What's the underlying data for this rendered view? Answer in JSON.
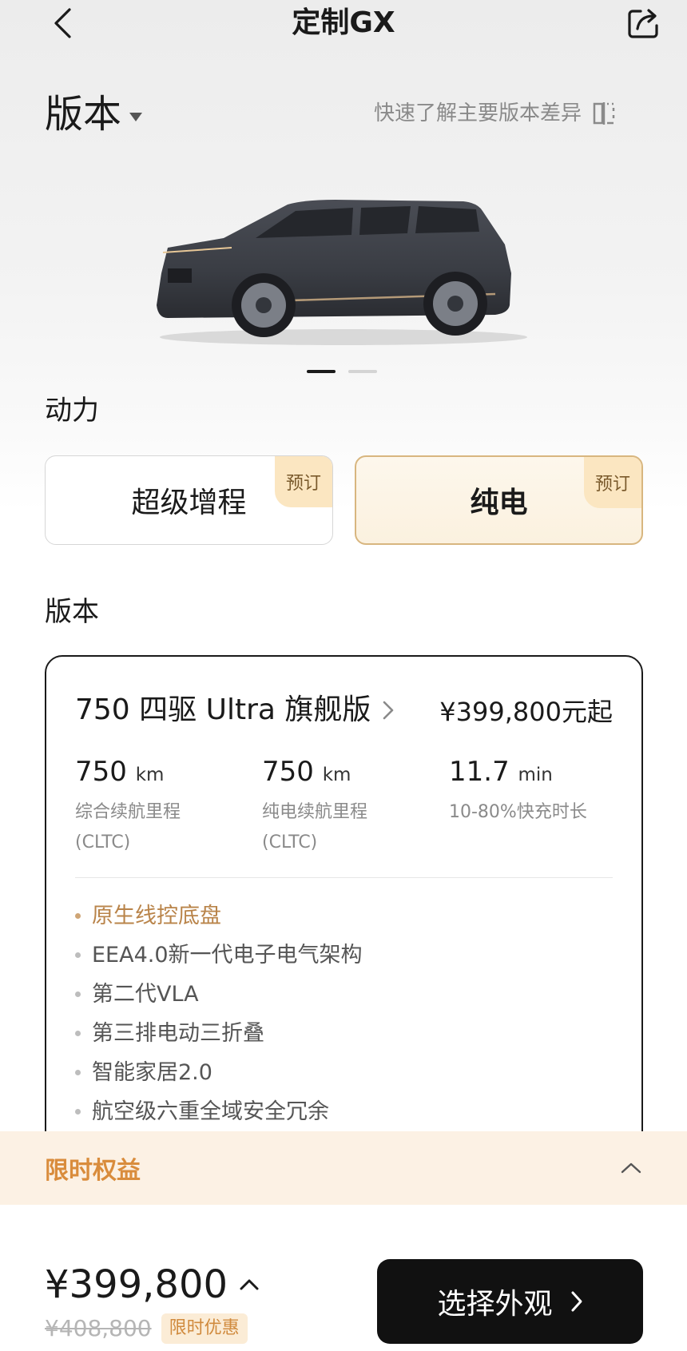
{
  "header": {
    "title": "定制GX",
    "back_icon": "chevron-left-icon",
    "share_icon": "share-icon"
  },
  "version_selector": {
    "label": "版本",
    "compare_link": "快速了解主要版本差异",
    "compare_icon": "compare-icon"
  },
  "carousel": {
    "image": "car-image",
    "slide_count": 2,
    "active_index": 0
  },
  "power": {
    "title": "动力",
    "options": [
      {
        "label": "超级增程",
        "tag": "预订",
        "selected": false
      },
      {
        "label": "纯电",
        "tag": "预订",
        "selected": true
      }
    ]
  },
  "versions": {
    "title": "版本",
    "selected": {
      "name": "750 四驱 Ultra 旗舰版",
      "price": "¥399,800元起",
      "specs": [
        {
          "value": "750",
          "unit": "km",
          "desc1": "综合续航里程",
          "desc2": "(CLTC)"
        },
        {
          "value": "750",
          "unit": "km",
          "desc1": "纯电续航里程",
          "desc2": "(CLTC)"
        },
        {
          "value": "11.7",
          "unit": "min",
          "desc1": "10-80%快充时长",
          "desc2": ""
        }
      ],
      "features": [
        "原生线控底盘",
        "EEA4.0新一代电子电气架构",
        "第二代VLA",
        "第三排电动三折叠",
        "智能家居2.0",
        "航空级六重全域安全冗余"
      ]
    }
  },
  "benefits": {
    "label": "限时权益",
    "icon": "chevron-up-icon"
  },
  "footer": {
    "price": "¥399,800",
    "original_price": "¥408,800",
    "promo_tag": "限时优惠",
    "cta_label": "选择外观"
  },
  "colors": {
    "accent": "#d8b67f",
    "highlight_text": "#b9844a",
    "benefit_text": "#d98c3c",
    "cta_bg": "#111111"
  }
}
